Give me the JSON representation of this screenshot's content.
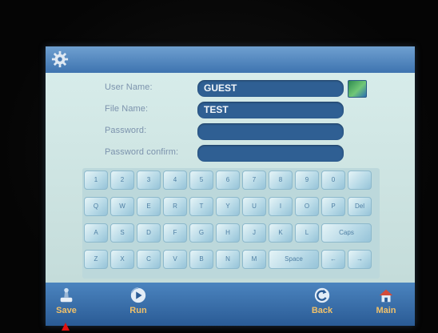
{
  "form": {
    "user_name_label": "User Name:",
    "user_name_value": "GUEST",
    "file_name_label": "File Name:",
    "file_name_value": "TEST",
    "password_label": "Password:",
    "password_value": "",
    "password_confirm_label": "Password confirm:",
    "password_confirm_value": ""
  },
  "keyboard": {
    "row1": [
      "1",
      "2",
      "3",
      "4",
      "5",
      "6",
      "7",
      "8",
      "9",
      "0",
      ""
    ],
    "row2": [
      "Q",
      "W",
      "E",
      "R",
      "T",
      "Y",
      "U",
      "I",
      "O",
      "P",
      "Del"
    ],
    "row3": [
      "A",
      "S",
      "D",
      "F",
      "G",
      "H",
      "J",
      "K",
      "L",
      "Caps"
    ],
    "row4": [
      "Z",
      "X",
      "C",
      "V",
      "B",
      "N",
      "M",
      "Space",
      "←",
      "→"
    ]
  },
  "bottom_bar": {
    "save": "Save",
    "run": "Run",
    "back": "Back",
    "main": "Main"
  },
  "colors": {
    "accent_bar": "#3e74b0",
    "field_fill": "#2f5f93",
    "button_text": "#f0c16a",
    "pointer_arrow": "#e01010"
  },
  "icons": {
    "settings": "gear-icon",
    "save": "save-icon",
    "run": "run-icon",
    "back": "back-icon",
    "main": "main-icon"
  }
}
